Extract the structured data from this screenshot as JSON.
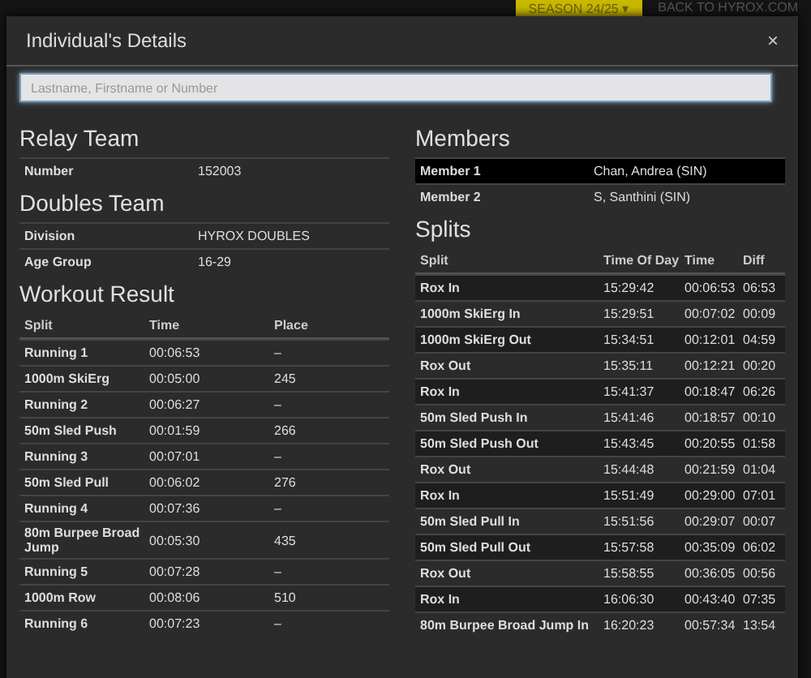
{
  "page": {
    "season_button": "SEASON 24/25 ▾",
    "back_link": "BACK TO HYROX.COM"
  },
  "modal": {
    "title": "Individual's Details",
    "close": "×",
    "search": {
      "placeholder": "Lastname, Firstname or Number"
    }
  },
  "relay_team": {
    "heading": "Relay Team",
    "rows": [
      {
        "label": "Number",
        "value": "152003"
      }
    ]
  },
  "doubles_team": {
    "heading": "Doubles Team",
    "rows": [
      {
        "label": "Division",
        "value": "HYROX DOUBLES"
      },
      {
        "label": "Age Group",
        "value": "16-29"
      }
    ]
  },
  "workout_result": {
    "heading": "Workout Result",
    "columns": [
      "Split",
      "Time",
      "Place"
    ],
    "rows": [
      [
        "Running 1",
        "00:06:53",
        "–"
      ],
      [
        "1000m SkiErg",
        "00:05:00",
        "245"
      ],
      [
        "Running 2",
        "00:06:27",
        "–"
      ],
      [
        "50m Sled Push",
        "00:01:59",
        "266"
      ],
      [
        "Running 3",
        "00:07:01",
        "–"
      ],
      [
        "50m Sled Pull",
        "00:06:02",
        "276"
      ],
      [
        "Running 4",
        "00:07:36",
        "–"
      ],
      [
        "80m Burpee Broad Jump",
        "00:05:30",
        "435"
      ],
      [
        "Running 5",
        "00:07:28",
        "–"
      ],
      [
        "1000m Row",
        "00:08:06",
        "510"
      ],
      [
        "Running 6",
        "00:07:23",
        "–"
      ]
    ]
  },
  "members": {
    "heading": "Members",
    "rows": [
      {
        "label": "Member 1",
        "value": "Chan, Andrea (SIN)",
        "highlighted": true
      },
      {
        "label": "Member 2",
        "value": "S, Santhini (SIN)",
        "highlighted": false
      }
    ]
  },
  "splits": {
    "heading": "Splits",
    "columns": [
      "Split",
      "Time Of Day",
      "Time",
      "Diff"
    ],
    "rows": [
      [
        "Rox In",
        "15:29:42",
        "00:06:53",
        "06:53"
      ],
      [
        "1000m SkiErg In",
        "15:29:51",
        "00:07:02",
        "00:09"
      ],
      [
        "1000m SkiErg Out",
        "15:34:51",
        "00:12:01",
        "04:59"
      ],
      [
        "Rox Out",
        "15:35:11",
        "00:12:21",
        "00:20"
      ],
      [
        "Rox In",
        "15:41:37",
        "00:18:47",
        "06:26"
      ],
      [
        "50m Sled Push In",
        "15:41:46",
        "00:18:57",
        "00:10"
      ],
      [
        "50m Sled Push Out",
        "15:43:45",
        "00:20:55",
        "01:58"
      ],
      [
        "Rox Out",
        "15:44:48",
        "00:21:59",
        "01:04"
      ],
      [
        "Rox In",
        "15:51:49",
        "00:29:00",
        "07:01"
      ],
      [
        "50m Sled Pull In",
        "15:51:56",
        "00:29:07",
        "00:07"
      ],
      [
        "50m Sled Pull Out",
        "15:57:58",
        "00:35:09",
        "06:02"
      ],
      [
        "Rox Out",
        "15:58:55",
        "00:36:05",
        "00:56"
      ],
      [
        "Rox In",
        "16:06:30",
        "00:43:40",
        "07:35"
      ],
      [
        "80m Burpee Broad Jump In",
        "16:20:23",
        "00:57:34",
        "13:54"
      ]
    ]
  }
}
